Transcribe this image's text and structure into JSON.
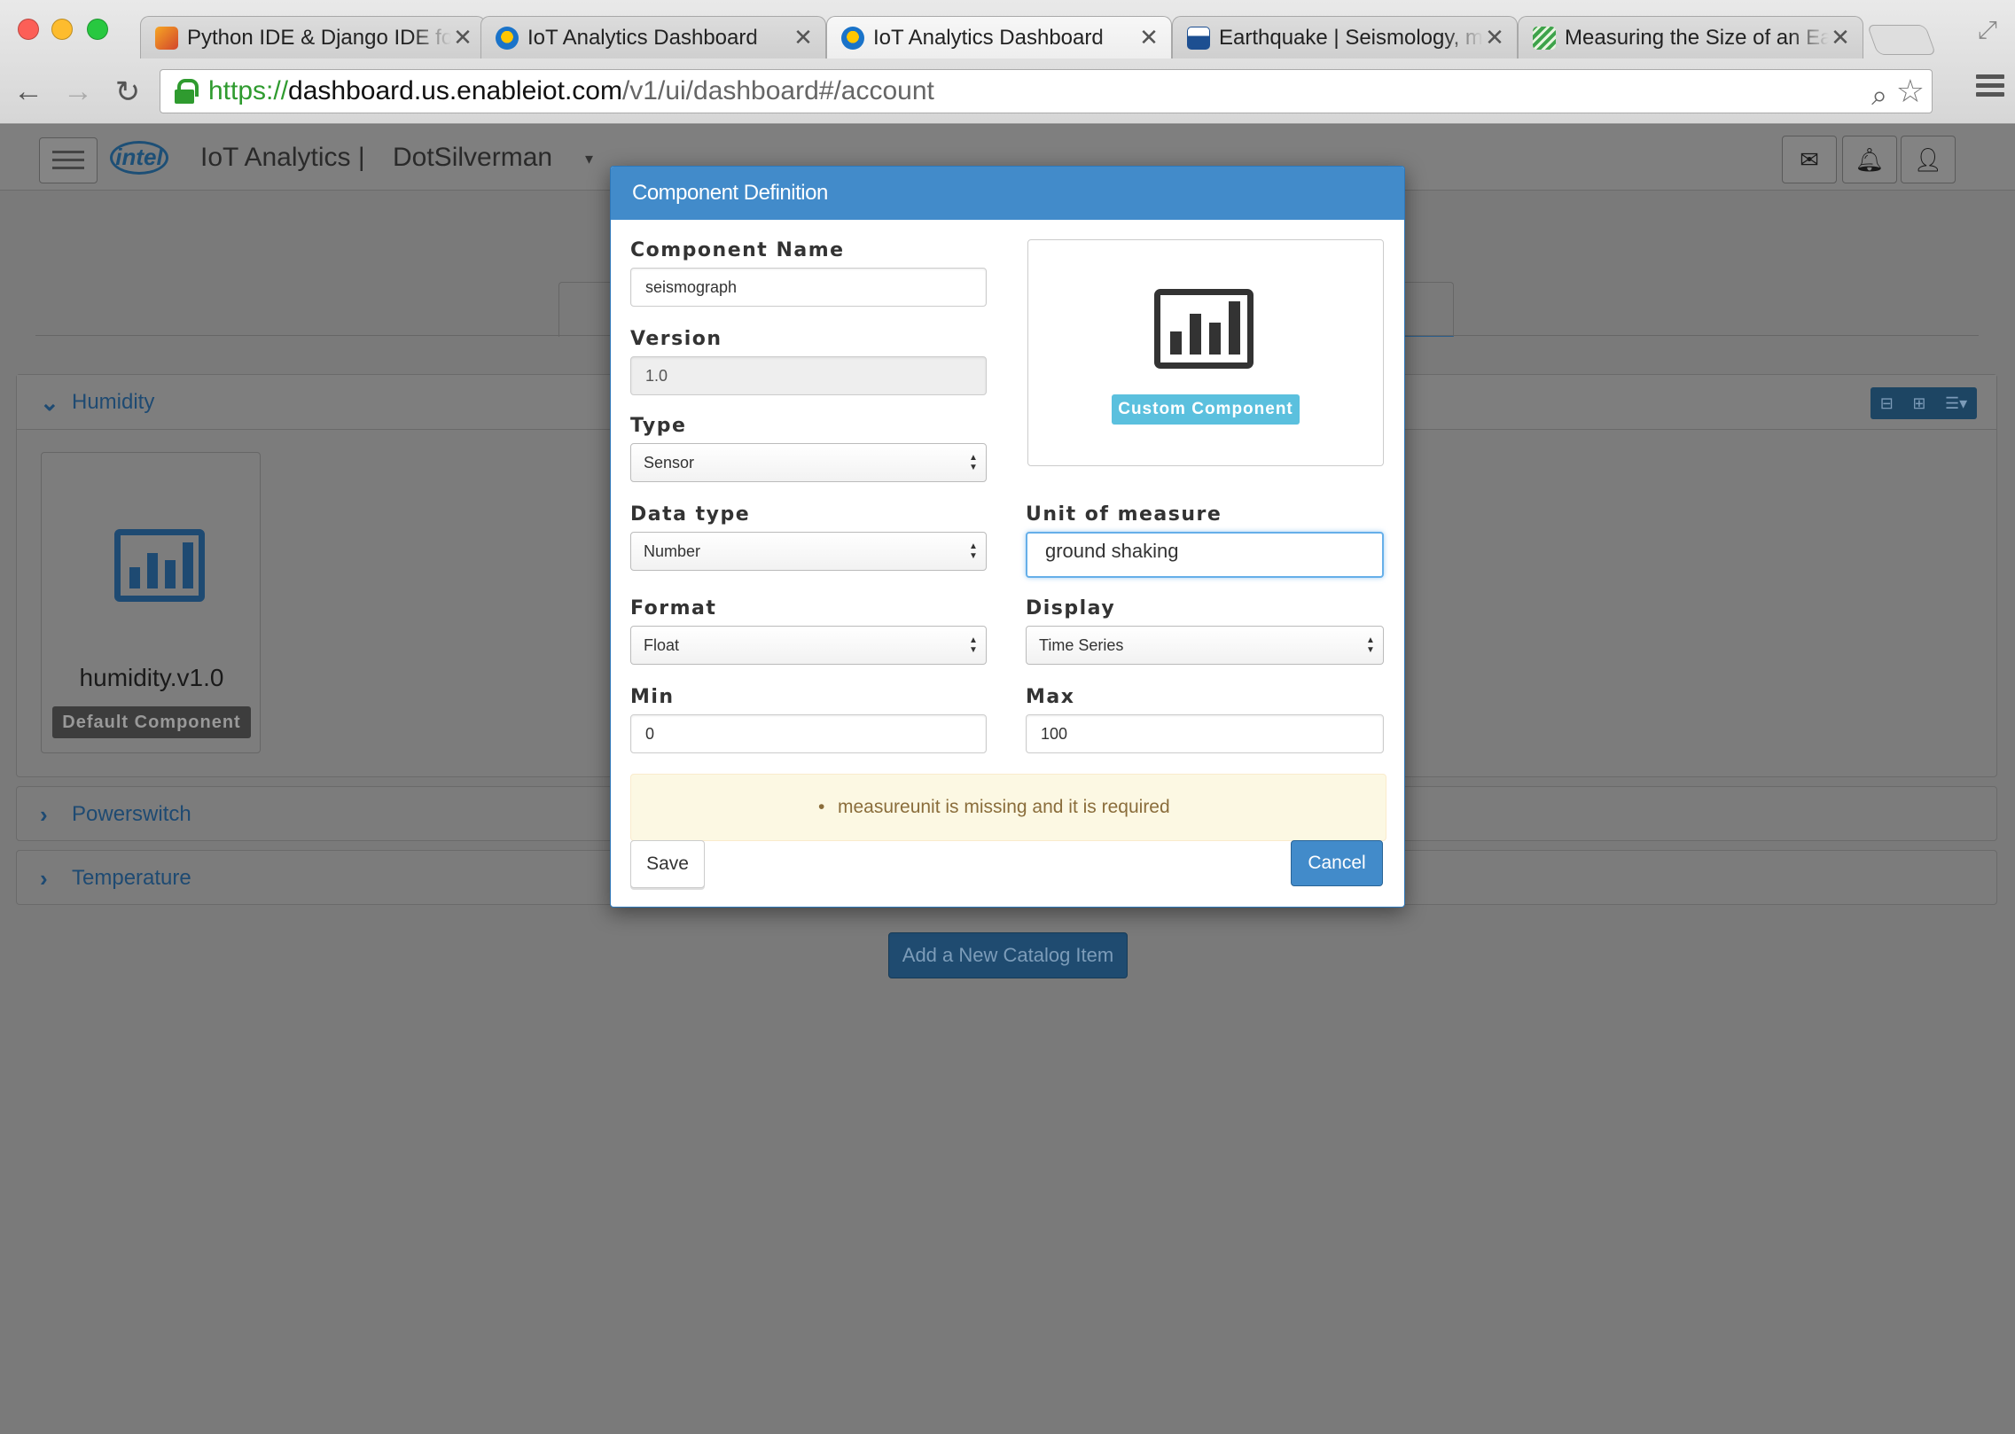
{
  "browser": {
    "tabs": [
      {
        "title": "Python IDE & Django IDE for Web developers",
        "favicon": "pycharm-icon",
        "active": false
      },
      {
        "title": "IoT Analytics Dashboard",
        "favicon": "iot-icon",
        "active": false
      },
      {
        "title": "IoT Analytics Dashboard",
        "favicon": "iot-icon",
        "active": true
      },
      {
        "title": "Earthquake | Seismology, measurement",
        "favicon": "usgs-icon",
        "active": false
      },
      {
        "title": "Measuring the Size of an Earthquake",
        "favicon": "measure-icon",
        "active": false
      }
    ],
    "tab_close": "✕",
    "url": {
      "scheme": "https://",
      "host": "dashboard.us.enableiot.com",
      "path": "/v1/ui/dashboard#/account"
    },
    "accent": "#2f9b2f"
  },
  "app": {
    "title": "IoT Analytics |",
    "account": "DotSilverman",
    "logo_text": "intel"
  },
  "catalog": {
    "panels": [
      {
        "name": "Humidity",
        "expanded": true
      },
      {
        "name": "Powerswitch",
        "expanded": false
      },
      {
        "name": "Temperature",
        "expanded": false
      }
    ],
    "humidity_card": {
      "name": "humidity.v1.0",
      "badge": "Default Component"
    },
    "add_button": "Add a New Catalog Item"
  },
  "modal": {
    "title": "Component Definition",
    "fields": {
      "component_name": {
        "label": "Component Name",
        "value": "seismograph"
      },
      "version": {
        "label": "Version",
        "value": "1.0"
      },
      "type": {
        "label": "Type",
        "value": "Sensor"
      },
      "data_type": {
        "label": "Data type",
        "value": "Number"
      },
      "unit": {
        "label": "Unit of measure",
        "value": "ground shaking"
      },
      "format": {
        "label": "Format",
        "value": "Float"
      },
      "display": {
        "label": "Display",
        "value": "Time Series"
      },
      "min": {
        "label": "Min",
        "value": "0"
      },
      "max": {
        "label": "Max",
        "value": "100"
      }
    },
    "preview_badge": "Custom Component",
    "error": "measureunit is missing and it is required",
    "save_label": "Save",
    "cancel_label": "Cancel",
    "colors": {
      "header": "#428bca",
      "badge": "#5bc0de",
      "alert_bg": "#fcf8e3"
    }
  }
}
